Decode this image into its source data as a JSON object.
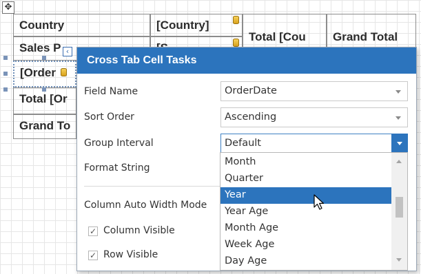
{
  "crosstab": {
    "cells": {
      "country": "Country",
      "country_field": "[Country]",
      "total_country": "Total [Cou",
      "grand_total_col": "Grand Total",
      "sales_person": "Sales P",
      "sales_field": "[S",
      "order": "[Order",
      "total_order": "Total [Or",
      "grand_total_row": "Grand To"
    }
  },
  "smart_tag": {
    "glyph": "‹"
  },
  "tasks": {
    "title": "Cross Tab Cell Tasks",
    "field_name_label": "Field Name",
    "field_name_value": "OrderDate",
    "sort_order_label": "Sort Order",
    "sort_order_value": "Ascending",
    "group_interval_label": "Group Interval",
    "group_interval_value": "Default",
    "format_string_label": "Format String",
    "column_auto_width_label": "Column Auto Width Mode",
    "column_visible_label": "Column Visible",
    "column_visible_checked": true,
    "row_visible_label": "Row Visible",
    "row_visible_checked": true
  },
  "dropdown": {
    "options": [
      "Month",
      "Quarter",
      "Year",
      "Year Age",
      "Month Age",
      "Week Age",
      "Day Age"
    ],
    "selected": "Year"
  },
  "icons": {
    "move": "move-arrows-icon",
    "database": "database-field-icon",
    "cursor": "mouse-cursor-icon"
  },
  "colors": {
    "accent": "#2c74bd",
    "grid_line": "#e6e6e6",
    "cell_border": "#8c8c8c"
  }
}
